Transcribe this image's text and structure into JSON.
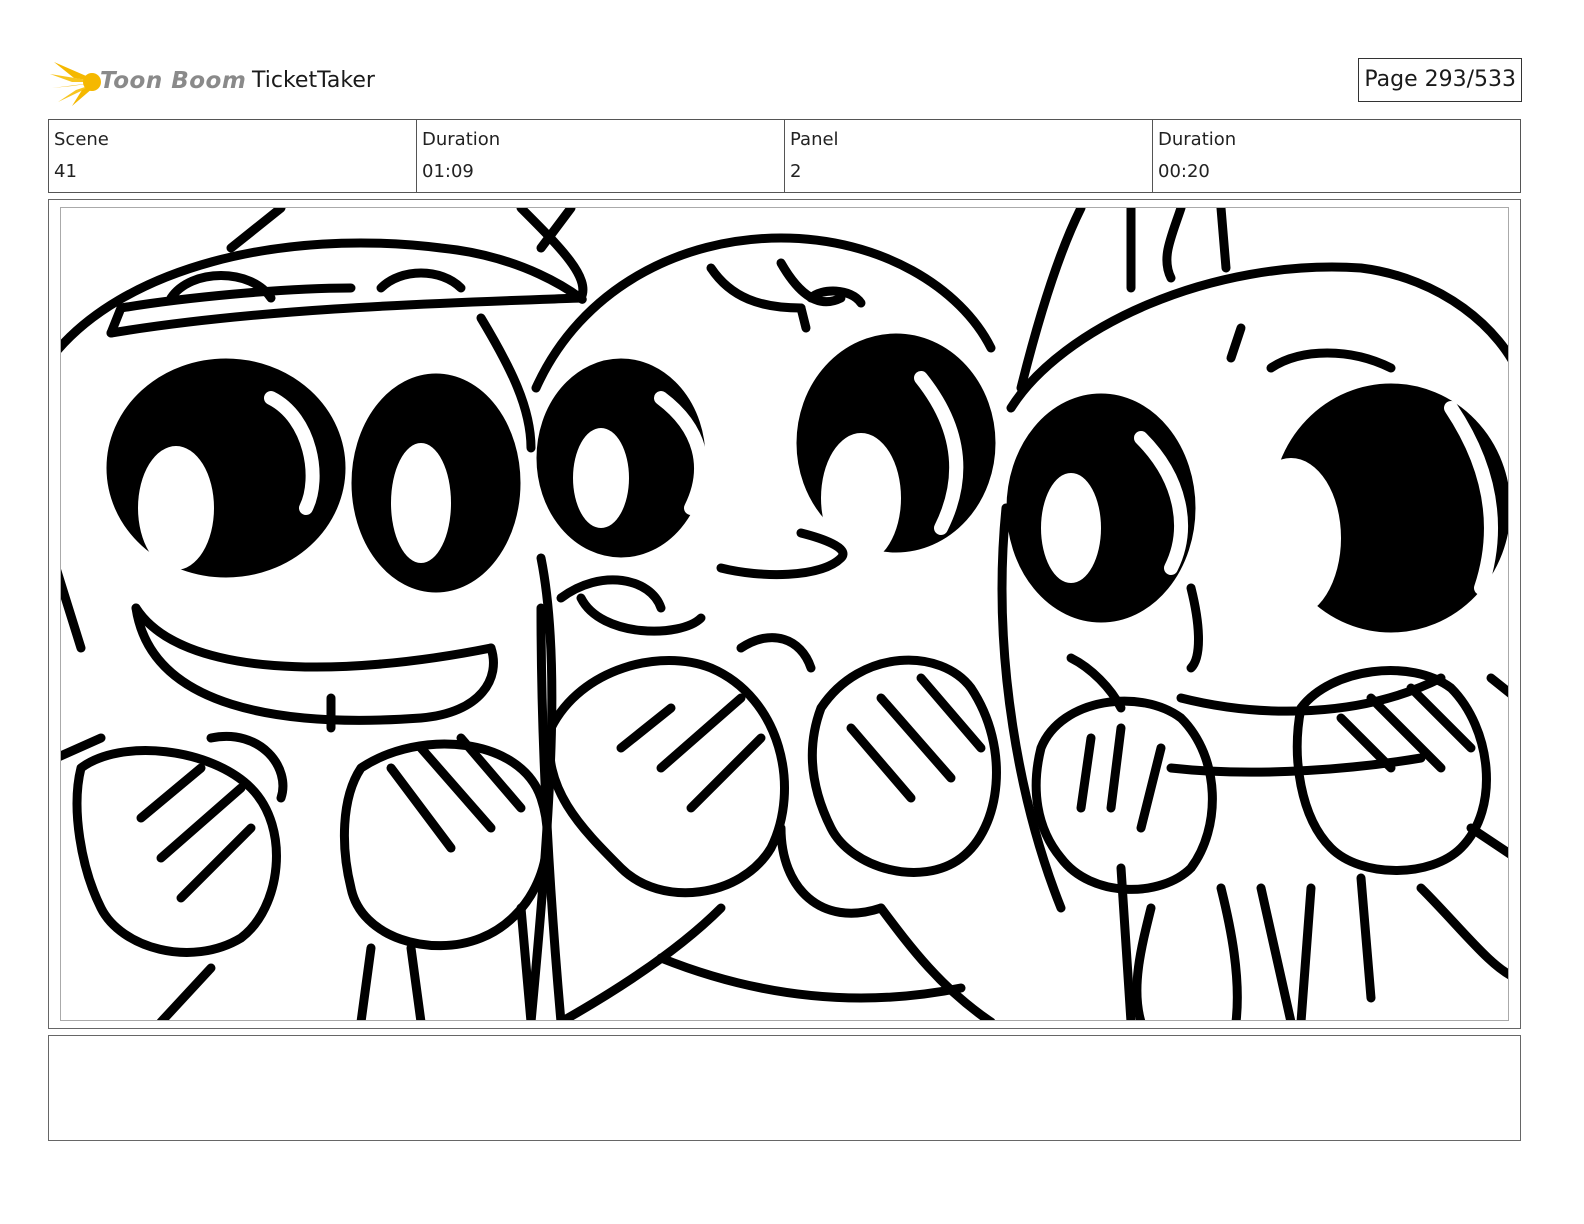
{
  "header": {
    "logo_text": "Toon Boom",
    "project_title": "TicketTaker",
    "page_counter": "Page 293/533"
  },
  "info": [
    {
      "label": "Scene",
      "value": "41"
    },
    {
      "label": "Duration",
      "value": "01:09"
    },
    {
      "label": "Panel",
      "value": "2"
    },
    {
      "label": "Duration",
      "value": "00:20"
    }
  ],
  "colors": {
    "logo_yellow": "#f5b800",
    "logo_text": "#8a8a8a",
    "ink": "#000000"
  },
  "notes": ""
}
